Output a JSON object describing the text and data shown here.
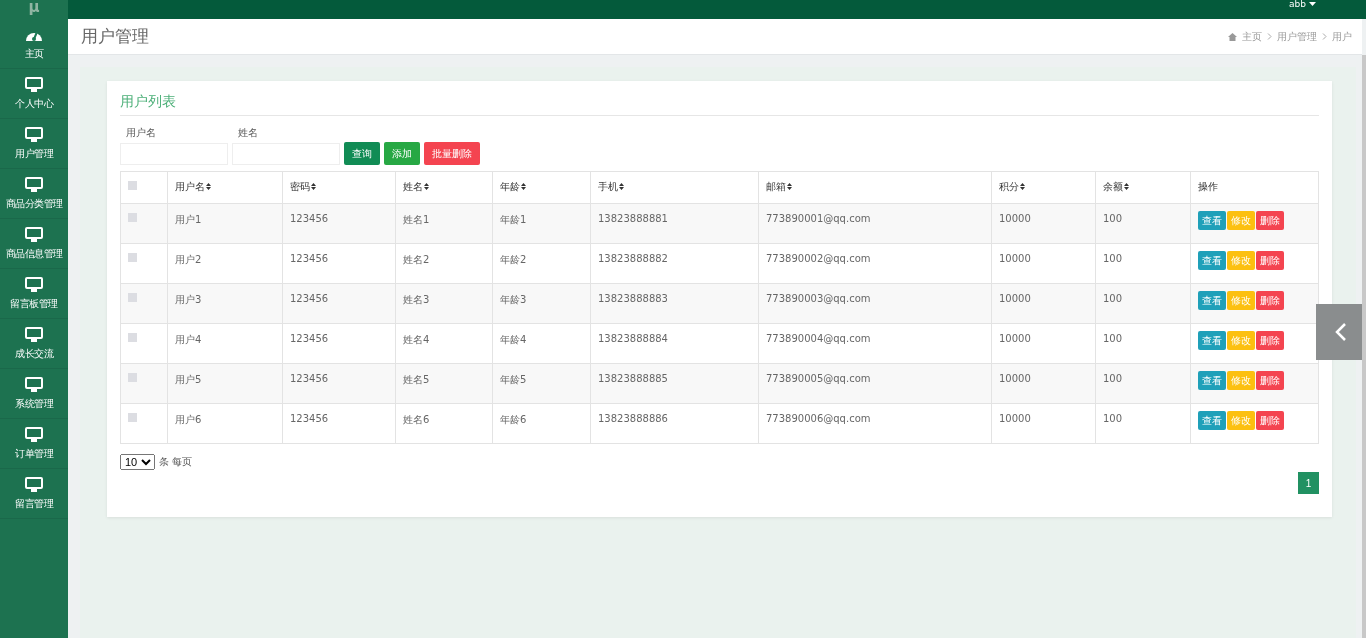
{
  "topbar": {
    "logo": "μ",
    "user": "abb"
  },
  "sidebar": {
    "items": [
      {
        "label": "主页",
        "kind": "dashboard"
      },
      {
        "label": "个人中心",
        "kind": "page"
      },
      {
        "label": "用户管理",
        "kind": "page"
      },
      {
        "label": "商品分类管理",
        "kind": "page"
      },
      {
        "label": "商品信息管理",
        "kind": "page"
      },
      {
        "label": "留言板管理",
        "kind": "page"
      },
      {
        "label": "成长交流",
        "kind": "page"
      },
      {
        "label": "系统管理",
        "kind": "page"
      },
      {
        "label": "订单管理",
        "kind": "page"
      },
      {
        "label": "留言管理",
        "kind": "page"
      }
    ]
  },
  "header": {
    "title": "用户管理",
    "breadcrumb": [
      "主页",
      "用户管理",
      "用户"
    ]
  },
  "card": {
    "title": "用户列表",
    "search": [
      {
        "label": "用户名"
      },
      {
        "label": "姓名"
      }
    ],
    "buttons": [
      {
        "label": "查询",
        "kind": "primary"
      },
      {
        "label": "添加",
        "kind": "success"
      },
      {
        "label": "批量删除",
        "kind": "danger"
      }
    ]
  },
  "table": {
    "select_all": {
      "checked": false
    },
    "columns": [
      "用户名",
      "密码",
      "姓名",
      "年龄",
      "手机",
      "邮箱",
      "积分",
      "余额",
      "操作"
    ],
    "rows": [
      {
        "checked": false,
        "cells": [
          "用户1",
          "123456",
          "姓名1",
          "年龄1",
          "13823888881",
          "773890001@qq.com",
          "10000",
          "100"
        ],
        "actions": [
          {
            "label": "查看",
            "kind": "info"
          },
          {
            "label": "修改",
            "kind": "warning"
          },
          {
            "label": "删除",
            "kind": "danger"
          }
        ]
      },
      {
        "checked": false,
        "cells": [
          "用户2",
          "123456",
          "姓名2",
          "年龄2",
          "13823888882",
          "773890002@qq.com",
          "10000",
          "100"
        ],
        "actions": [
          {
            "label": "查看",
            "kind": "info"
          },
          {
            "label": "修改",
            "kind": "warning"
          },
          {
            "label": "删除",
            "kind": "danger"
          }
        ]
      },
      {
        "checked": false,
        "cells": [
          "用户3",
          "123456",
          "姓名3",
          "年龄3",
          "13823888883",
          "773890003@qq.com",
          "10000",
          "100"
        ],
        "actions": [
          {
            "label": "查看",
            "kind": "info"
          },
          {
            "label": "修改",
            "kind": "warning"
          },
          {
            "label": "删除",
            "kind": "danger"
          }
        ]
      },
      {
        "checked": false,
        "cells": [
          "用户4",
          "123456",
          "姓名4",
          "年龄4",
          "13823888884",
          "773890004@qq.com",
          "10000",
          "100"
        ],
        "actions": [
          {
            "label": "查看",
            "kind": "info"
          },
          {
            "label": "修改",
            "kind": "warning"
          },
          {
            "label": "删除",
            "kind": "danger"
          }
        ]
      },
      {
        "checked": false,
        "cells": [
          "用户5",
          "123456",
          "姓名5",
          "年龄5",
          "13823888885",
          "773890005@qq.com",
          "10000",
          "100"
        ],
        "actions": [
          {
            "label": "查看",
            "kind": "info"
          },
          {
            "label": "修改",
            "kind": "warning"
          },
          {
            "label": "删除",
            "kind": "danger"
          }
        ]
      },
      {
        "checked": false,
        "cells": [
          "用户6",
          "123456",
          "姓名6",
          "年龄6",
          "13823888886",
          "773890006@qq.com",
          "10000",
          "100"
        ],
        "actions": [
          {
            "label": "查看",
            "kind": "info"
          },
          {
            "label": "修改",
            "kind": "warning"
          },
          {
            "label": "删除",
            "kind": "danger"
          }
        ]
      }
    ]
  },
  "page_size": {
    "value": "10",
    "suffix": "条 每页"
  },
  "pagination": [
    {
      "label": "1",
      "selected": true
    }
  ]
}
